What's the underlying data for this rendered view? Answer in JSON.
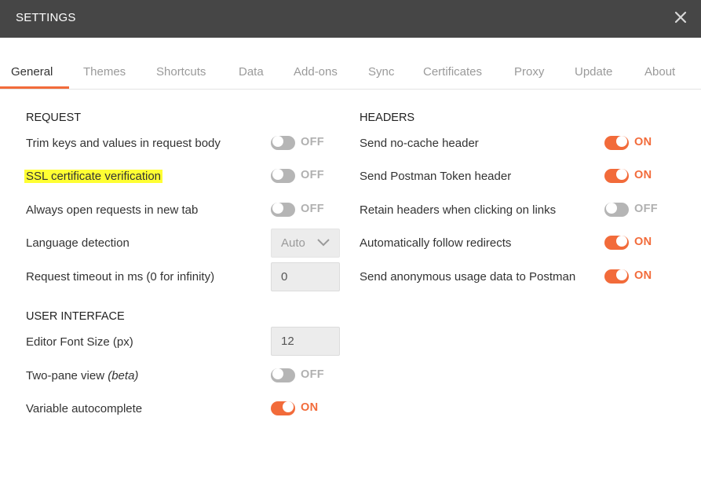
{
  "window": {
    "title": "SETTINGS",
    "close_icon": "close-icon"
  },
  "tabs": [
    {
      "label": "General",
      "active": true
    },
    {
      "label": "Themes"
    },
    {
      "label": "Shortcuts"
    },
    {
      "label": "Data"
    },
    {
      "label": "Add-ons"
    },
    {
      "label": "Sync"
    },
    {
      "label": "Certificates"
    },
    {
      "label": "Proxy"
    },
    {
      "label": "Update"
    },
    {
      "label": "About"
    }
  ],
  "request": {
    "title": "REQUEST",
    "trim_keys": {
      "label": "Trim keys and values in request body",
      "state": "OFF"
    },
    "ssl_verification": {
      "label": "SSL certificate verification",
      "state": "OFF"
    },
    "open_new_tab": {
      "label": "Always open requests in new tab",
      "state": "OFF"
    },
    "language_detection": {
      "label": "Language detection",
      "value": "Auto"
    },
    "request_timeout": {
      "label": "Request timeout in ms (0 for infinity)",
      "value": "0"
    }
  },
  "user_interface": {
    "title": "USER INTERFACE",
    "editor_font_size": {
      "label": "Editor Font Size (px)",
      "value": "12"
    },
    "two_pane_view": {
      "label": "Two-pane view ",
      "label_suffix": "(beta)",
      "state": "OFF"
    },
    "variable_autocomplete": {
      "label": "Variable autocomplete",
      "state": "ON"
    }
  },
  "headers": {
    "title": "HEADERS",
    "no_cache": {
      "label": "Send no-cache header",
      "state": "ON"
    },
    "postman_token": {
      "label": "Send Postman Token header",
      "state": "ON"
    },
    "retain_headers": {
      "label": "Retain headers when clicking on links",
      "state": "OFF"
    },
    "follow_redirects": {
      "label": "Automatically follow redirects",
      "state": "ON"
    },
    "anonymous_usage": {
      "label": "Send anonymous usage data to Postman",
      "state": "ON"
    }
  },
  "colors": {
    "accent": "#f26b3a",
    "titlebar": "#464646",
    "highlight": "#ffff33",
    "toggle_off": "#b5b5b5"
  }
}
